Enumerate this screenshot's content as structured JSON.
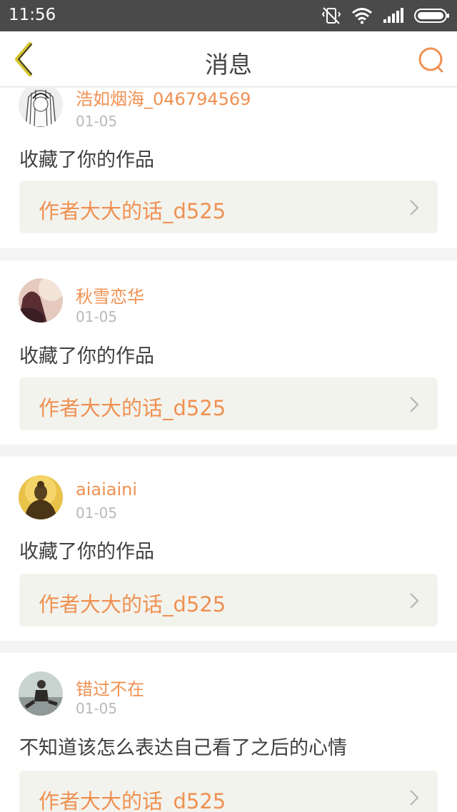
{
  "status": {
    "time": "11:56"
  },
  "header": {
    "title": "消息"
  },
  "colors": {
    "accent": "#ef9152",
    "back_arrow": "#d6c22a",
    "status_bg": "#4a4a4a"
  },
  "messages": [
    {
      "name": "浩如烟海_046794569",
      "date": "01-05",
      "action": "收藏了你的作品",
      "link": "作者大大的话_d525",
      "avatar": "anime-sketch-avatar"
    },
    {
      "name": "秋雪恋华",
      "date": "01-05",
      "action": "收藏了你的作品",
      "link": "作者大大的话_d525",
      "avatar": "portrait-avatar"
    },
    {
      "name": "aiaiaini",
      "date": "01-05",
      "action": "收藏了你的作品",
      "link": "作者大大的话_d525",
      "avatar": "buddha-avatar"
    },
    {
      "name": "错过不在",
      "date": "01-05",
      "action": "不知道该怎么表达自己看了之后的心情",
      "link": "作者大大的话_d525",
      "avatar": "person-sitting-avatar"
    }
  ]
}
